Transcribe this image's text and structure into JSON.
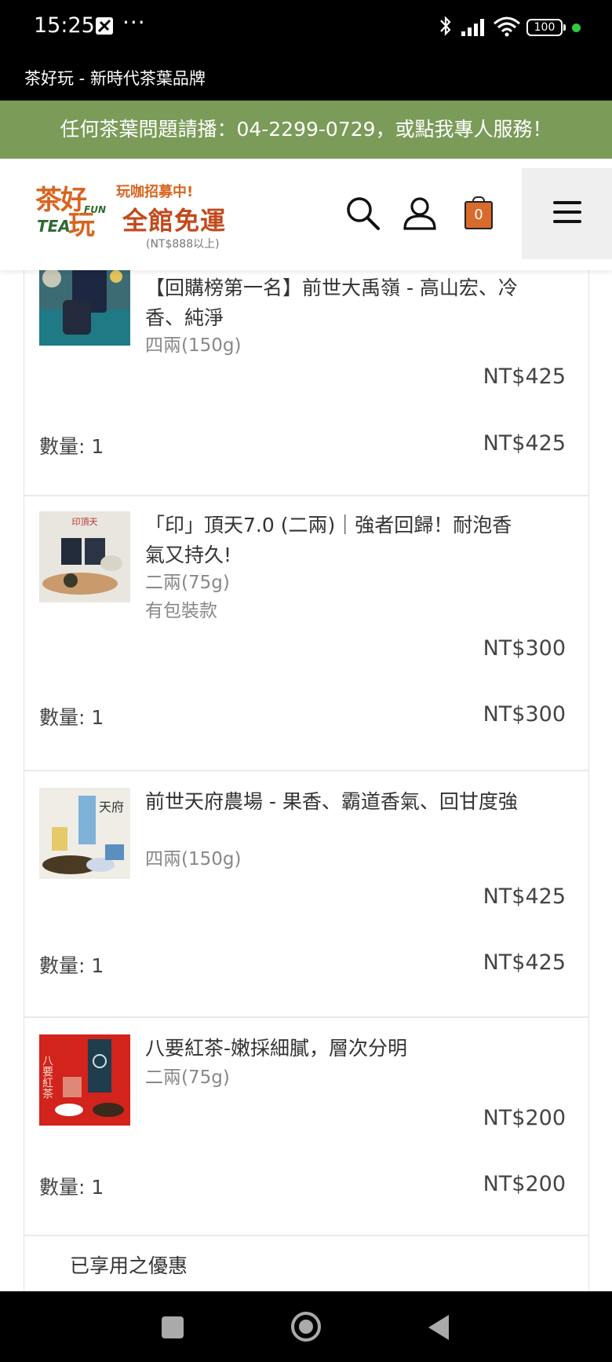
{
  "status_bar": {
    "time": "15:25",
    "more": "···",
    "battery": "100"
  },
  "app_title": "茶好玩 - 新時代茶葉品牌",
  "promo_bar": "任何茶葉問題請播：04-2299-0729，或點我專人服務！",
  "header": {
    "logo_text": "茶好玩",
    "logo_tea": "TEA",
    "logo_fun": "FUN",
    "banner_line1": "玩咖招募中!",
    "banner_line2": "全館免運",
    "banner_line3": "(NT$888以上)",
    "cart_count": "0"
  },
  "cart_items": [
    {
      "name": "【回購榜第一名】前世大禹嶺 - 高山宏、冷香、純淨",
      "variant": "四兩(150g)",
      "extra": "",
      "price": "NT$425",
      "qty_label": "數量: 1",
      "total": "NT$425"
    },
    {
      "name": "「印」頂天7.0 (二兩)｜強者回歸！耐泡香氣又持久!",
      "variant": "二兩(75g)",
      "extra": "有包裝款",
      "price": "NT$300",
      "qty_label": "數量: 1",
      "total": "NT$300",
      "thumb_label": "印頂天"
    },
    {
      "name": "前世天府農場 - 果香、霸道香氣、回甘度強",
      "variant": "四兩(150g)",
      "extra": "",
      "price": "NT$425",
      "qty_label": "數量: 1",
      "total": "NT$425",
      "thumb_label": "天府"
    },
    {
      "name": "八要紅茶-嫩採細膩，層次分明",
      "variant": "二兩(75g)",
      "extra": "",
      "price": "NT$200",
      "qty_label": "數量: 1",
      "total": "NT$200",
      "thumb_label": "八要紅茶"
    }
  ],
  "discount_heading": "已享用之優惠",
  "colors": {
    "promo_bg": "#7b9b59",
    "brand_orange": "#d9641f",
    "cart_orange": "#d86a2c"
  }
}
